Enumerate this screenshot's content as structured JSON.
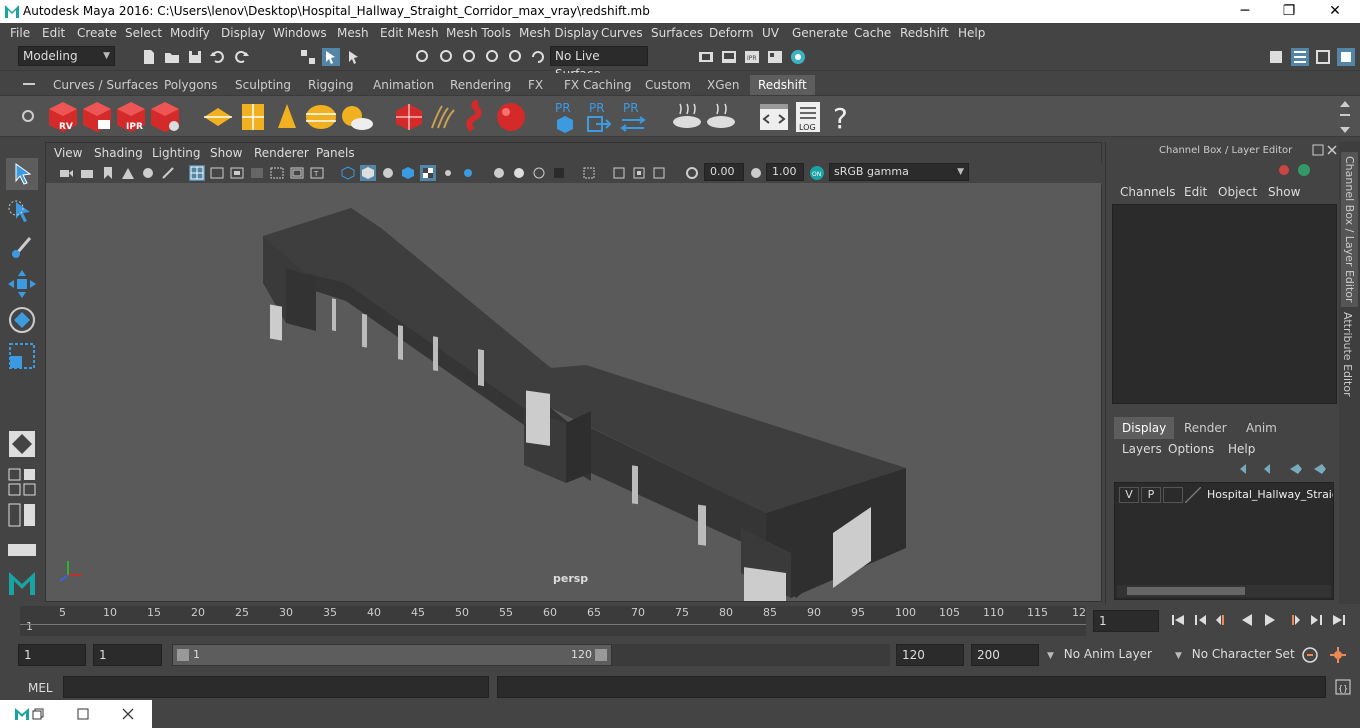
{
  "window": {
    "title": "Autodesk Maya 2016: C:\\Users\\lenov\\Desktop\\Hospital_Hallway_Straight_Corridor_max_vray\\redshift.mb",
    "minimize": "─",
    "maximize": "❐",
    "close": "✕"
  },
  "menubar": [
    "File",
    "Edit",
    "Create",
    "Select",
    "Modify",
    "Display",
    "Windows",
    "Mesh",
    "Edit Mesh",
    "Mesh Tools",
    "Mesh Display",
    "Curves",
    "Surfaces",
    "Deform",
    "UV",
    "Generate",
    "Cache",
    "Redshift",
    "Help"
  ],
  "statusline": {
    "mode": "Modeling",
    "live_surface": "No Live Surface"
  },
  "shelf_tabs": [
    "Curves / Surfaces",
    "Polygons",
    "Sculpting",
    "Rigging",
    "Animation",
    "Rendering",
    "FX",
    "FX Caching",
    "Custom",
    "XGen",
    "Redshift"
  ],
  "shelf_active": "Redshift",
  "shelf": {
    "rv": "RV",
    "ipr": "IPR",
    "pr1": "PR",
    "pr2": "PR",
    "pr3": "PR",
    "log": "LOG",
    "help": "?"
  },
  "viewport": {
    "menu": [
      "View",
      "Shading",
      "Lighting",
      "Show",
      "Renderer",
      "Panels"
    ],
    "exposure": "0.00",
    "gamma": "1.00",
    "color_space": "sRGB gamma",
    "camera": "persp"
  },
  "channel_box": {
    "title": "Channel Box / Layer Editor",
    "menu": [
      "Channels",
      "Edit",
      "Object",
      "Show"
    ]
  },
  "layer_editor": {
    "tabs": [
      "Display",
      "Render",
      "Anim"
    ],
    "active_tab": "Display",
    "menu": [
      "Layers",
      "Options",
      "Help"
    ],
    "layer": {
      "v": "V",
      "p": "P",
      "name": "Hospital_Hallway_Straigl"
    }
  },
  "side_tabs": [
    "Channel Box / Layer Editor",
    "Attribute Editor"
  ],
  "timeline": {
    "ticks": [
      "5",
      "10",
      "15",
      "20",
      "25",
      "30",
      "35",
      "40",
      "45",
      "50",
      "55",
      "60",
      "65",
      "70",
      "75",
      "80",
      "85",
      "90",
      "95",
      "100",
      "105",
      "110",
      "115",
      "12"
    ],
    "start_marker": "1",
    "current_frame": "1"
  },
  "range": {
    "start": "1",
    "playback_start": "1",
    "slider_start": "1",
    "slider_end": "120",
    "playback_end": "120",
    "end": "200",
    "anim_layer": "No Anim Layer",
    "character_set": "No Character Set"
  },
  "command": {
    "label": "MEL"
  },
  "colors": {
    "accent": "#5285a6",
    "ui_bg": "#444444",
    "viewport_bg": "#5a5a5a",
    "redshift_red": "#d42a2a"
  }
}
